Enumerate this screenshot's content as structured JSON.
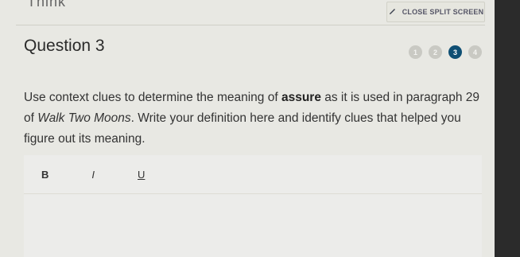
{
  "header": {
    "top_text": "Think",
    "close_split_label": "CLOSE SPLIT SCREEN",
    "close_split_icon": "pencil-icon"
  },
  "question": {
    "title": "Question 3",
    "pager": [
      "1",
      "2",
      "3",
      "4"
    ],
    "active_page": "3",
    "prompt_prefix": "Use context clues to determine the meaning of ",
    "prompt_term": "assure",
    "prompt_middle": " as it is used in paragraph 29 of ",
    "prompt_work": "Walk Two Moons",
    "prompt_suffix": ". Write your definition here and identify clues that helped you figure out its meaning."
  },
  "editor": {
    "bold_label": "B",
    "italic_label": "I",
    "underline_label": "U"
  },
  "colors": {
    "active_page": "#0f4f74",
    "panel_bg": "#e8e8e3"
  }
}
